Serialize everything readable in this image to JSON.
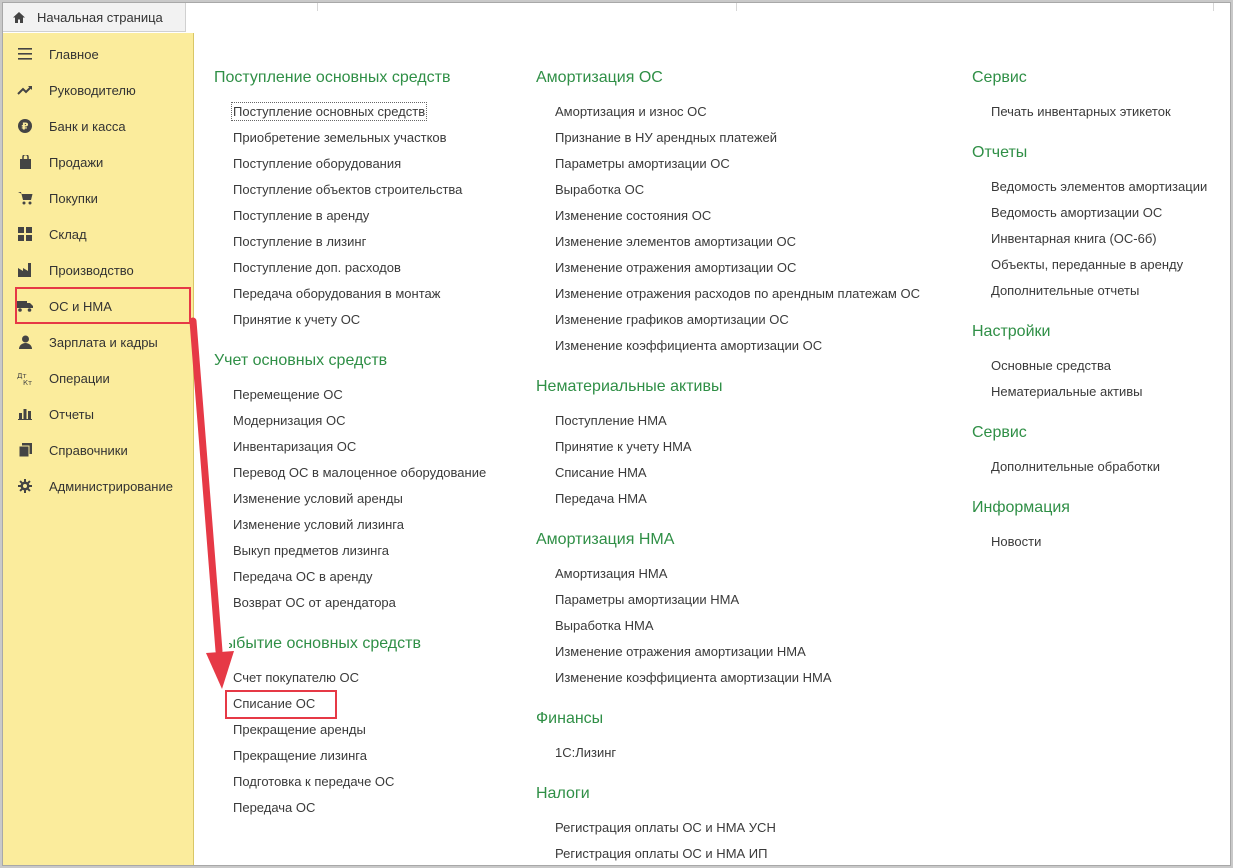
{
  "tab": {
    "home_label": "Начальная страница"
  },
  "sidebar": {
    "items": [
      {
        "label": "Главное",
        "icon": "menu-icon"
      },
      {
        "label": "Руководителю",
        "icon": "trend-up-icon"
      },
      {
        "label": "Банк и касса",
        "icon": "ruble-icon"
      },
      {
        "label": "Продажи",
        "icon": "bag-icon"
      },
      {
        "label": "Покупки",
        "icon": "cart-icon"
      },
      {
        "label": "Склад",
        "icon": "grid-icon"
      },
      {
        "label": "Производство",
        "icon": "factory-icon"
      },
      {
        "label": "ОС и НМА",
        "icon": "truck-icon"
      },
      {
        "label": "Зарплата и кадры",
        "icon": "person-icon"
      },
      {
        "label": "Операции",
        "icon": "dt-kt-icon"
      },
      {
        "label": "Отчеты",
        "icon": "bar-chart-icon"
      },
      {
        "label": "Справочники",
        "icon": "books-icon"
      },
      {
        "label": "Администрирование",
        "icon": "gear-icon"
      }
    ]
  },
  "col1": {
    "s1_title": "Поступление основных средств",
    "s1_items": [
      "Поступление основных средств",
      "Приобретение земельных участков",
      "Поступление оборудования",
      "Поступление объектов строительства",
      "Поступление в аренду",
      "Поступление в лизинг",
      "Поступление доп. расходов",
      "Передача оборудования в монтаж",
      "Принятие к учету ОС"
    ],
    "s2_title": "Учет основных средств",
    "s2_items": [
      "Перемещение ОС",
      "Модернизация ОС",
      "Инвентаризация ОС",
      "Перевод ОС в малоценное оборудование",
      "Изменение условий аренды",
      "Изменение условий лизинга",
      "Выкуп предметов лизинга",
      "Передача ОС в аренду",
      "Возврат ОС от арендатора"
    ],
    "s3_title": "Выбытие основных средств",
    "s3_items": [
      "Счет покупателю ОС",
      "Списание ОС",
      "Прекращение аренды",
      "Прекращение лизинга",
      "Подготовка к передаче ОС",
      "Передача ОС"
    ]
  },
  "col2": {
    "s1_title": "Амортизация ОС",
    "s1_items": [
      "Амортизация и износ ОС",
      "Признание в НУ арендных платежей",
      "Параметры амортизации ОС",
      "Выработка ОС",
      "Изменение состояния ОС",
      "Изменение элементов амортизации ОС",
      "Изменение отражения амортизации ОС",
      "Изменение отражения расходов по арендным платежам ОС",
      "Изменение графиков амортизации ОС",
      "Изменение коэффициента амортизации ОС"
    ],
    "s2_title": "Нематериальные активы",
    "s2_items": [
      "Поступление НМА",
      "Принятие к учету НМА",
      "Списание НМА",
      "Передача НМА"
    ],
    "s3_title": "Амортизация НМА",
    "s3_items": [
      "Амортизация НМА",
      "Параметры амортизации НМА",
      "Выработка НМА",
      "Изменение отражения амортизации НМА",
      "Изменение коэффициента амортизации НМА"
    ],
    "s4_title": "Финансы",
    "s4_items": [
      "1С:Лизинг"
    ],
    "s5_title": "Налоги",
    "s5_items": [
      "Регистрация оплаты ОС и НМА УСН",
      "Регистрация оплаты ОС и НМА ИП"
    ]
  },
  "col3": {
    "s1_title": "Сервис",
    "s1_items": [
      "Печать инвентарных этикеток"
    ],
    "s2_title": "Отчеты",
    "s2_items": [
      "Ведомость элементов амортизации",
      "Ведомость амортизации ОС",
      "Инвентарная книга (ОС-6б)",
      "Объекты, переданные в аренду",
      "Дополнительные отчеты"
    ],
    "s3_title": "Настройки",
    "s3_items": [
      "Основные средства",
      "Нематериальные активы"
    ],
    "s4_title": "Сервис",
    "s4_items": [
      "Дополнительные обработки"
    ],
    "s5_title": "Информация",
    "s5_items": [
      "Новости"
    ]
  },
  "colors": {
    "sidebar_bg": "#fbec9c",
    "section_title": "#2f8f46",
    "annotation_red": "#e63946"
  }
}
